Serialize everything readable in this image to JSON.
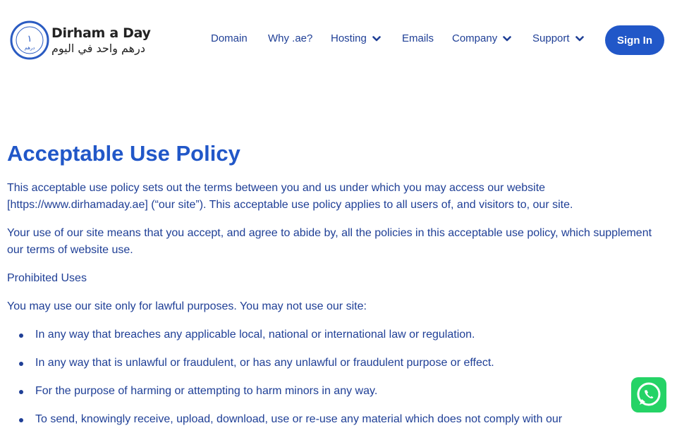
{
  "logo": {
    "title": "Dirham a Day",
    "subtitle_arabic": "درهم واحد في اليوم",
    "seal_numeral": "١",
    "seal_text": "درهم"
  },
  "nav": {
    "items": [
      {
        "label": "Domain",
        "has_dropdown": false
      },
      {
        "label": "Why .ae?",
        "has_dropdown": false
      },
      {
        "label": "Hosting",
        "has_dropdown": true
      },
      {
        "label": "Emails",
        "has_dropdown": false
      },
      {
        "label": "Company",
        "has_dropdown": true
      },
      {
        "label": "Support",
        "has_dropdown": true
      }
    ],
    "signin_label": "Sign In"
  },
  "content": {
    "title": "Acceptable Use Policy",
    "paragraphs": [
      "This acceptable use policy sets out the terms between you and us under which you may access our website [https://www.dirhamaday.ae] (“our site”). This acceptable use policy applies to all users of, and visitors to, our site.",
      "Your use of our site means that you accept, and agree to abide by, all the policies in this acceptable use policy, which supplement our terms of website use.",
      "Prohibited Uses",
      "You may use our site only for lawful purposes. You may not use our site:"
    ],
    "list": [
      "In any way that breaches any applicable local, national or international law or regulation.",
      "In any way that is unlawful or fraudulent, or has any unlawful or fraudulent purpose or effect.",
      "For the purpose of harming or attempting to harm minors in any way.",
      "To send, knowingly receive, upload, download, use or re-use any material which does not comply with our"
    ]
  },
  "colors": {
    "primary": "#2157c8",
    "text": "#1f3f96",
    "whatsapp": "#25d366"
  },
  "icons": {
    "dropdown": "chevron-down-icon",
    "chat": "whatsapp-icon"
  }
}
